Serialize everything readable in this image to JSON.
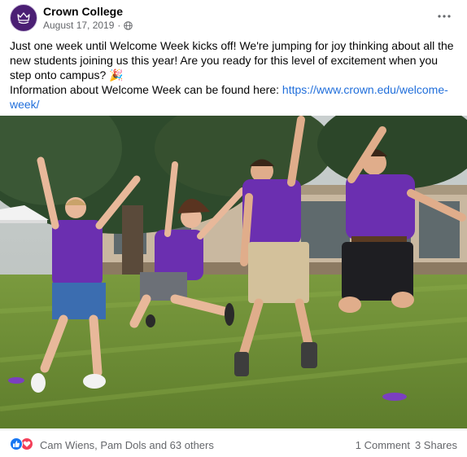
{
  "post": {
    "page_name": "Crown College",
    "date": "August 17, 2019",
    "separator": "·",
    "text_lines": [
      "Just one week until Welcome Week kicks off! We're jumping for joy thinking about all the new students joining us this year! Are you ready for this level of excitement when you step onto campus? 🎉"
    ],
    "info_prefix": "Information about Welcome Week can be found here: ",
    "link": "https://www.crown.edu/welcome-week/"
  },
  "reactions": {
    "icons": [
      "like-icon",
      "love-icon"
    ],
    "reactors": "Cam Wiens, Pam Dols and 63 others",
    "comments": "1 Comment",
    "shares": "3 Shares"
  },
  "colors": {
    "brand_purple": "#4b1f74",
    "link_blue": "#216fdb",
    "like_blue": "#1877f2",
    "love_red": "#f33e58",
    "secondary_text": "#65676b"
  }
}
